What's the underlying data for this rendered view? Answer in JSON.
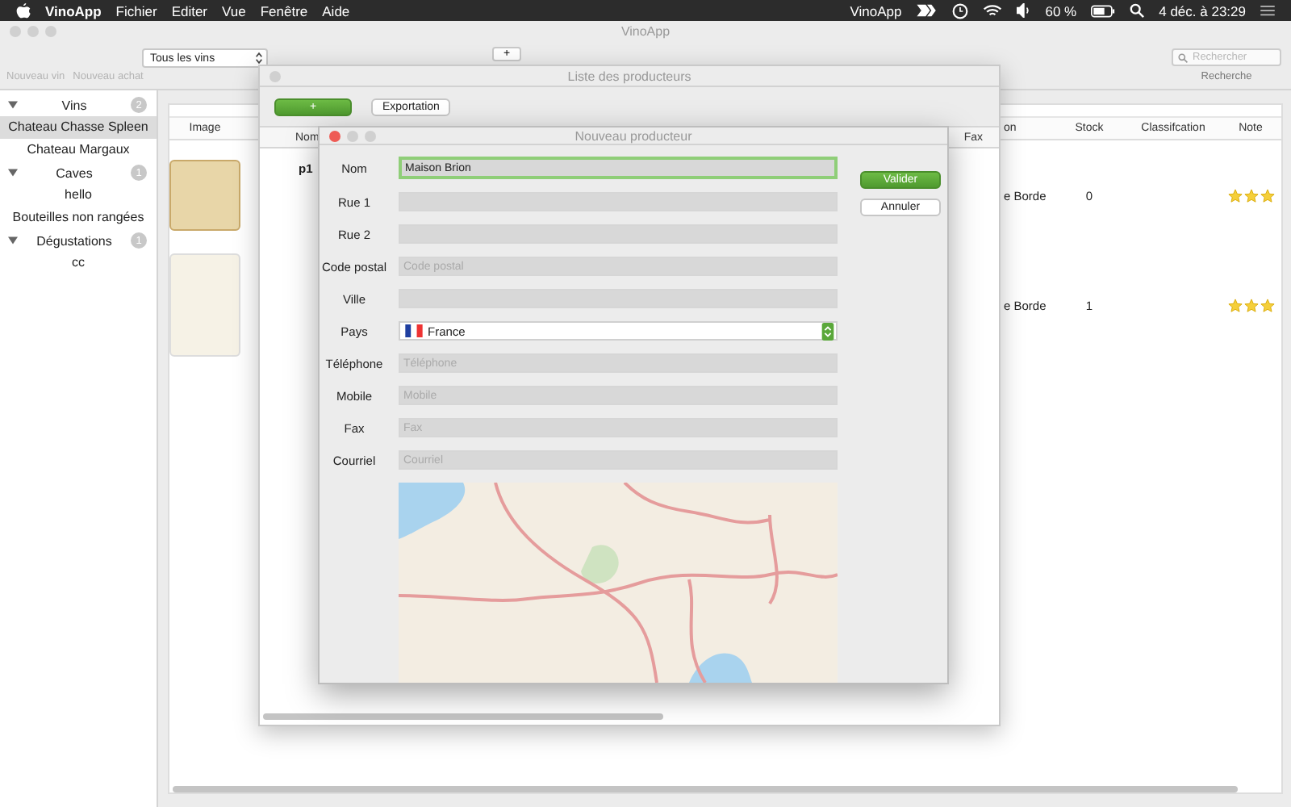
{
  "menu_bar": {
    "app": "VinoApp",
    "menus": [
      "Fichier",
      "Editer",
      "Vue",
      "Fenêtre",
      "Aide"
    ],
    "status_app": "VinoApp",
    "battery": "60 %",
    "clock": "4 déc. à 23:29"
  },
  "main_window": {
    "title": "VinoApp",
    "filter": "Tous les vins",
    "add_button": "+",
    "toolbar_actions": [
      {
        "label": "Nouveau vin",
        "disabled": true
      },
      {
        "label": "Nouveau achat",
        "disabled": true
      }
    ],
    "search": {
      "placeholder": "Rechercher",
      "label": "Recherche"
    }
  },
  "sidebar": {
    "items": [
      {
        "label": "Vins",
        "count": "2",
        "expanded": true,
        "children": [
          {
            "label": "Chateau Chasse Spleen",
            "selected": true
          },
          {
            "label": "Chateau Margaux",
            "selected": false
          }
        ]
      },
      {
        "label": "Caves",
        "count": "1",
        "expanded": true,
        "children": [
          {
            "label": "hello",
            "selected": false
          },
          {
            "label": "Bouteilles non rangées",
            "selected": false
          }
        ]
      },
      {
        "label": "Dégustations",
        "count": "1",
        "expanded": true,
        "children": [
          {
            "label": "cc",
            "selected": false
          }
        ]
      }
    ]
  },
  "wines_table": {
    "columns": [
      "Image",
      "on",
      "Stock",
      "Classifcation",
      "Note"
    ],
    "rows": [
      {
        "column_2": "e Borde",
        "stock": "0",
        "stars": 3
      },
      {
        "column_2": "e Borde",
        "stock": "1",
        "stars": 3
      }
    ]
  },
  "producers_window": {
    "title": "Liste des producteurs",
    "add_button": "+",
    "export_button": "Exportation",
    "columns": [
      "Nom",
      "Fax"
    ],
    "rows": [
      {
        "nom": "p1"
      }
    ]
  },
  "dialog": {
    "title": "Nouveau producteur",
    "fields": [
      {
        "label": "Nom",
        "kind": "text",
        "value": "Maison Brion",
        "focused": true
      },
      {
        "label": "Rue 1",
        "kind": "text",
        "focused": false
      },
      {
        "label": "Rue 2",
        "kind": "text",
        "focused": false
      },
      {
        "label": "Code postal",
        "kind": "text",
        "placeholder": "Code postal",
        "focused": false
      },
      {
        "label": "Ville",
        "kind": "text",
        "focused": false
      },
      {
        "label": "Pays",
        "kind": "select",
        "value": "France",
        "focused": false
      },
      {
        "label": "Téléphone",
        "kind": "text",
        "placeholder": "Téléphone",
        "focused": false
      },
      {
        "label": "Mobile",
        "kind": "text",
        "placeholder": "Mobile",
        "focused": false
      },
      {
        "label": "Fax",
        "kind": "text",
        "placeholder": "Fax",
        "focused": false
      },
      {
        "label": "Courriel",
        "kind": "text",
        "placeholder": "Courriel",
        "focused": false
      }
    ],
    "confirm_button": "Valider",
    "cancel_button": "Annuler"
  }
}
